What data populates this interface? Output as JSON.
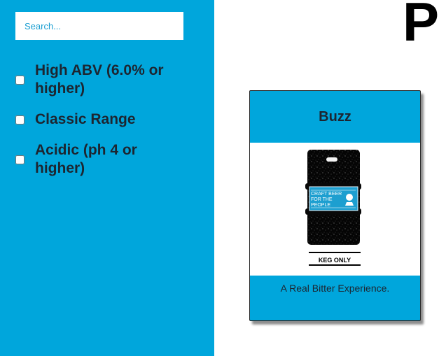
{
  "search": {
    "placeholder": "Search..."
  },
  "filters": [
    {
      "label": "High ABV (6.0% or higher)",
      "checked": false
    },
    {
      "label": "Classic Range",
      "checked": false
    },
    {
      "label": "Acidic (ph 4 or higher)",
      "checked": false
    }
  ],
  "main": {
    "title": "P"
  },
  "beer": {
    "name": "Buzz",
    "description": "A Real Bitter Experience.",
    "image": {
      "label_text": "CRAFT BEER FOR THE PEOPLE",
      "keg_label": "KEG ONLY"
    }
  },
  "colors": {
    "sidebar_background": "#00a6dc",
    "card_background": "#00a6dc",
    "text_dark": "#1d2530",
    "search_text": "#1b9fd2"
  },
  "icons": {
    "beer_logo": "beer-keg-image-icon"
  }
}
